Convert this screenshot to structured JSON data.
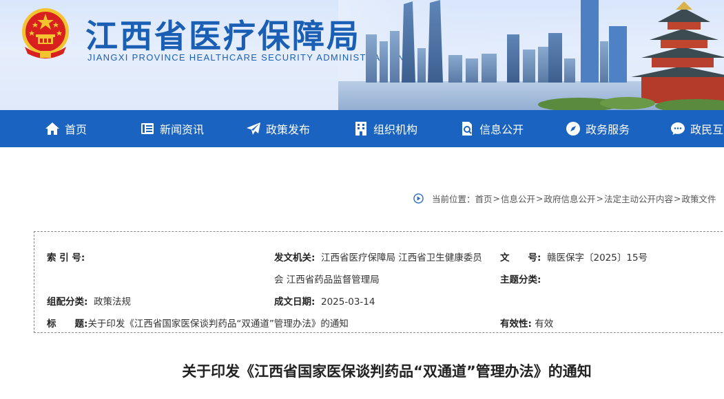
{
  "site": {
    "title_cn": "江西省医疗保障局",
    "title_en": "JIANGXI PROVINCE HEALTHCARE SECURITY ADMINISTRATION"
  },
  "nav": {
    "items": [
      {
        "label": "首页",
        "icon": "home-icon"
      },
      {
        "label": "新闻资讯",
        "icon": "news-icon"
      },
      {
        "label": "政策发布",
        "icon": "paper-plane-icon"
      },
      {
        "label": "组织机构",
        "icon": "building-icon"
      },
      {
        "label": "信息公开",
        "icon": "document-search-icon"
      },
      {
        "label": "政务服务",
        "icon": "compass-icon"
      },
      {
        "label": "政民互动",
        "icon": "chat-icon"
      }
    ]
  },
  "breadcrumb": {
    "prefix": "当前位置：",
    "items": [
      "首页",
      "信息公开",
      "政府信息公开",
      "法定主动公开内容",
      "政策文件"
    ]
  },
  "meta": {
    "index_label": "索 引 号:",
    "index_value": "",
    "issuer_label": "发文机关:",
    "issuer_value_line1": "江西省医疗保障局 江西省卫生健康委员",
    "issuer_value_line2": "会 江西省药品监督管理局",
    "docno_label": "文　　号:",
    "docno_value": "赣医保字〔2025〕15号",
    "topic_label": "主题分类:",
    "topic_value": "",
    "category_label": "组配分类:",
    "category_value": "政策法规",
    "date_label": "成文日期:",
    "date_value": "2025-03-14",
    "title_label": "标　　题:",
    "title_value": "关于印发《江西省国家医保谈判药品“双通道”管理办法》的通知",
    "validity_label": "有效性:",
    "validity_value": "有效"
  },
  "article": {
    "title": "关于印发《江西省国家医保谈判药品“双通道”管理办法》的通知"
  },
  "colors": {
    "brand_blue": "#1a5fb4",
    "nav_blue": "#1b63c0"
  }
}
